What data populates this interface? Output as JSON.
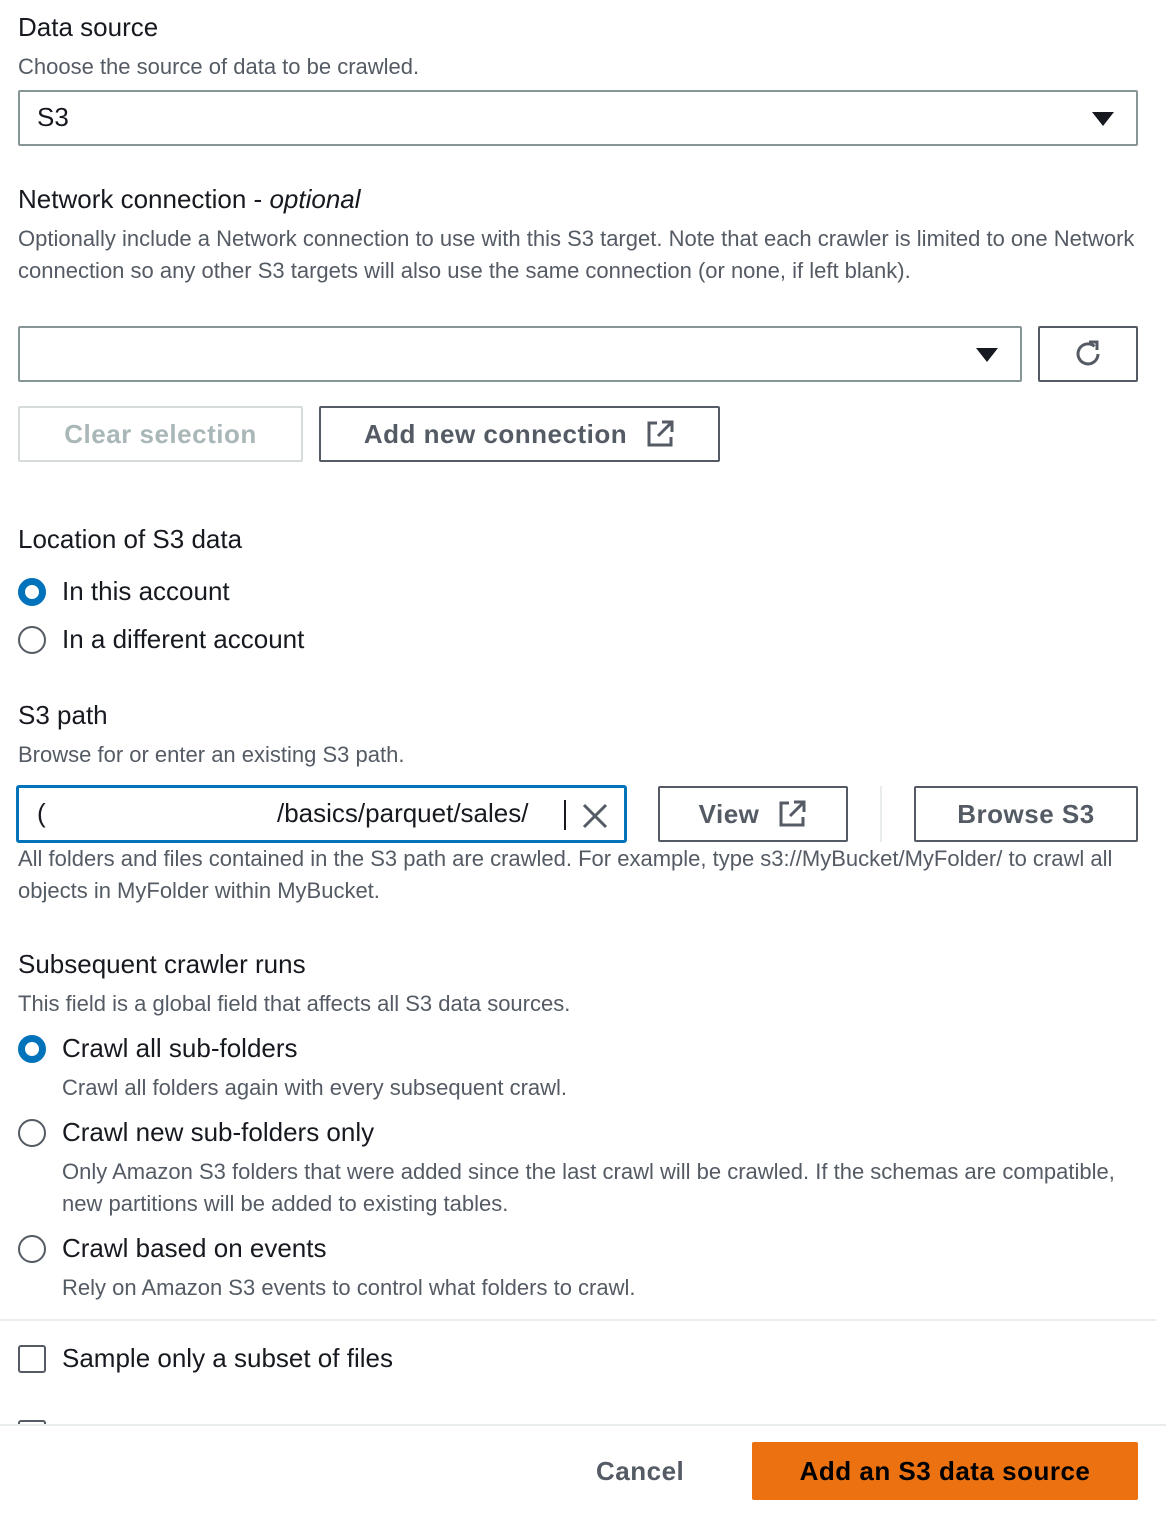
{
  "data_source": {
    "label": "Data source",
    "description": "Choose the source of data to be crawled.",
    "selected": "S3"
  },
  "network": {
    "label": "Network connection - ",
    "label_optional": "optional",
    "description": "Optionally include a Network connection to use with this S3 target. Note that each crawler is limited to one Network connection so any other S3 targets will also use the same connection (or none, if left blank).",
    "selected": "",
    "clear_label": "Clear selection",
    "add_label": "Add new connection"
  },
  "location": {
    "label": "Location of S3 data",
    "options": [
      "In this account",
      "In a different account"
    ],
    "selected": "In this account"
  },
  "s3_path": {
    "label": "S3 path",
    "description": "Browse for or enter an existing S3 path.",
    "value_prefix": "(",
    "value": "/basics/parquet/sales/",
    "view_label": "View",
    "browse_label": "Browse S3",
    "help": "All folders and files contained in the S3 path are crawled. For example, type s3://MyBucket/MyFolder/ to crawl all objects in MyFolder within MyBucket."
  },
  "subsequent": {
    "label": "Subsequent crawler runs",
    "description": "This field is a global field that affects all S3 data sources.",
    "options": [
      {
        "label": "Crawl all sub-folders",
        "desc": "Crawl all folders again with every subsequent crawl."
      },
      {
        "label": "Crawl new sub-folders only",
        "desc": "Only Amazon S3 folders that were added since the last crawl will be crawled. If the schemas are compatible, new partitions will be added to existing tables."
      },
      {
        "label": "Crawl based on events",
        "desc": "Rely on Amazon S3 events to control what folders to crawl."
      }
    ],
    "selected": "Crawl all sub-folders"
  },
  "sample": {
    "label": "Sample only a subset of files",
    "checked": false
  },
  "footer": {
    "cancel_label": "Cancel",
    "submit_label": "Add an S3 data source"
  },
  "colors": {
    "accent": "#0073bb",
    "primary": "#ec7211",
    "border": "#879596",
    "text_secondary": "#545b64"
  }
}
